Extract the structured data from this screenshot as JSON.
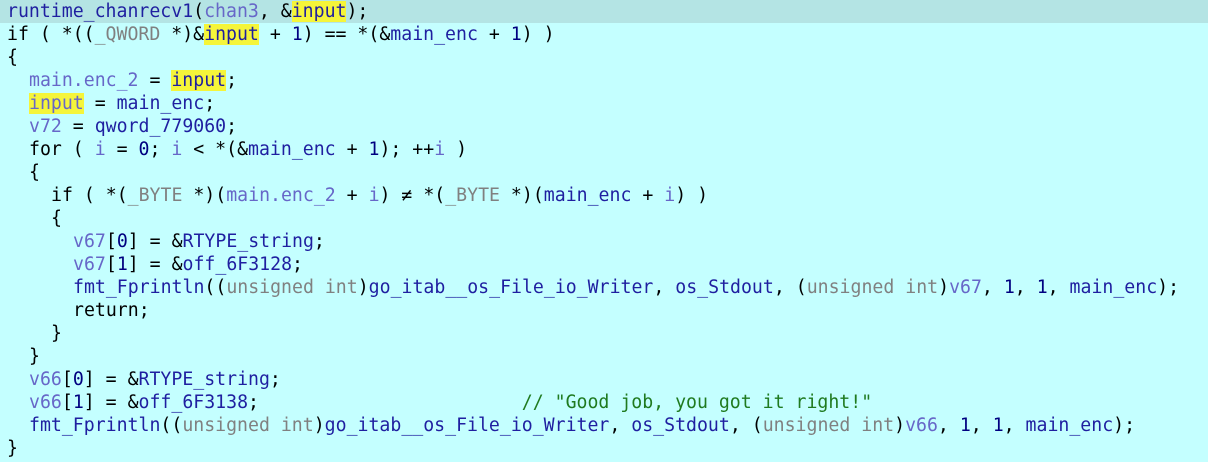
{
  "editor": {
    "lines": [
      {
        "indent": 0,
        "current": true,
        "tokens": [
          {
            "t": "runtime_chanrecv1",
            "c": "name"
          },
          {
            "t": "(",
            "c": "op"
          },
          {
            "t": "chan3",
            "c": "var"
          },
          {
            "t": ", &",
            "c": "op"
          },
          {
            "t": "input",
            "c": "name",
            "hl": true
          },
          {
            "t": ");",
            "c": "op"
          }
        ]
      },
      {
        "indent": 0,
        "tokens": [
          {
            "t": "if ( *((",
            "c": "kw"
          },
          {
            "t": "_QWORD",
            "c": "type"
          },
          {
            "t": " *)&",
            "c": "op"
          },
          {
            "t": "input",
            "c": "name",
            "hl": true
          },
          {
            "t": " + ",
            "c": "op"
          },
          {
            "t": "1",
            "c": "num"
          },
          {
            "t": ") == *(&",
            "c": "op"
          },
          {
            "t": "main_enc",
            "c": "name"
          },
          {
            "t": " + ",
            "c": "op"
          },
          {
            "t": "1",
            "c": "num"
          },
          {
            "t": ") )",
            "c": "op"
          }
        ]
      },
      {
        "indent": 0,
        "tokens": [
          {
            "t": "{",
            "c": "op"
          }
        ]
      },
      {
        "indent": 1,
        "tokens": [
          {
            "t": "main.enc_2",
            "c": "var"
          },
          {
            "t": " = ",
            "c": "op"
          },
          {
            "t": "input",
            "c": "name",
            "hl": true
          },
          {
            "t": ";",
            "c": "op"
          }
        ]
      },
      {
        "indent": 1,
        "tokens": [
          {
            "t": "input",
            "c": "var",
            "hl": true
          },
          {
            "t": " = ",
            "c": "op"
          },
          {
            "t": "main_enc",
            "c": "name"
          },
          {
            "t": ";",
            "c": "op"
          }
        ]
      },
      {
        "indent": 1,
        "tokens": [
          {
            "t": "v72",
            "c": "var"
          },
          {
            "t": " = ",
            "c": "op"
          },
          {
            "t": "qword_779060",
            "c": "name"
          },
          {
            "t": ";",
            "c": "op"
          }
        ]
      },
      {
        "indent": 1,
        "tokens": [
          {
            "t": "for ( ",
            "c": "kw"
          },
          {
            "t": "i",
            "c": "var"
          },
          {
            "t": " = ",
            "c": "op"
          },
          {
            "t": "0",
            "c": "num"
          },
          {
            "t": "; ",
            "c": "op"
          },
          {
            "t": "i",
            "c": "var"
          },
          {
            "t": " < *(&",
            "c": "op"
          },
          {
            "t": "main_enc",
            "c": "name"
          },
          {
            "t": " + ",
            "c": "op"
          },
          {
            "t": "1",
            "c": "num"
          },
          {
            "t": "); ++",
            "c": "op"
          },
          {
            "t": "i",
            "c": "var"
          },
          {
            "t": " )",
            "c": "op"
          }
        ]
      },
      {
        "indent": 1,
        "tokens": [
          {
            "t": "{",
            "c": "op"
          }
        ]
      },
      {
        "indent": 2,
        "tokens": [
          {
            "t": "if ( *(",
            "c": "kw"
          },
          {
            "t": "_BYTE",
            "c": "type"
          },
          {
            "t": " *)(",
            "c": "op"
          },
          {
            "t": "main.enc_2",
            "c": "var"
          },
          {
            "t": " + ",
            "c": "op"
          },
          {
            "t": "i",
            "c": "var"
          },
          {
            "t": ") ≠ *(",
            "c": "op"
          },
          {
            "t": "_BYTE",
            "c": "type"
          },
          {
            "t": " *)(",
            "c": "op"
          },
          {
            "t": "main_enc",
            "c": "name"
          },
          {
            "t": " + ",
            "c": "op"
          },
          {
            "t": "i",
            "c": "var"
          },
          {
            "t": ") )",
            "c": "op"
          }
        ]
      },
      {
        "indent": 2,
        "tokens": [
          {
            "t": "{",
            "c": "op"
          }
        ]
      },
      {
        "indent": 3,
        "tokens": [
          {
            "t": "v67",
            "c": "var"
          },
          {
            "t": "[",
            "c": "op"
          },
          {
            "t": "0",
            "c": "num"
          },
          {
            "t": "] = &",
            "c": "op"
          },
          {
            "t": "RTYPE_string",
            "c": "name"
          },
          {
            "t": ";",
            "c": "op"
          }
        ]
      },
      {
        "indent": 3,
        "tokens": [
          {
            "t": "v67",
            "c": "var"
          },
          {
            "t": "[",
            "c": "op"
          },
          {
            "t": "1",
            "c": "num"
          },
          {
            "t": "] = &",
            "c": "op"
          },
          {
            "t": "off_6F3128",
            "c": "name"
          },
          {
            "t": ";",
            "c": "op"
          }
        ]
      },
      {
        "indent": 3,
        "tokens": [
          {
            "t": "fmt_Fprintln",
            "c": "name"
          },
          {
            "t": "((",
            "c": "op"
          },
          {
            "t": "unsigned int",
            "c": "type"
          },
          {
            "t": ")",
            "c": "op"
          },
          {
            "t": "go_itab__os_File_io_Writer",
            "c": "name"
          },
          {
            "t": ", ",
            "c": "op"
          },
          {
            "t": "os_Stdout",
            "c": "name"
          },
          {
            "t": ", (",
            "c": "op"
          },
          {
            "t": "unsigned int",
            "c": "type"
          },
          {
            "t": ")",
            "c": "op"
          },
          {
            "t": "v67",
            "c": "var"
          },
          {
            "t": ", ",
            "c": "op"
          },
          {
            "t": "1",
            "c": "num"
          },
          {
            "t": ", ",
            "c": "op"
          },
          {
            "t": "1",
            "c": "num"
          },
          {
            "t": ", ",
            "c": "op"
          },
          {
            "t": "main_enc",
            "c": "name"
          },
          {
            "t": ");",
            "c": "op"
          }
        ]
      },
      {
        "indent": 3,
        "tokens": [
          {
            "t": "return;",
            "c": "kw"
          }
        ]
      },
      {
        "indent": 2,
        "tokens": [
          {
            "t": "}",
            "c": "op"
          }
        ]
      },
      {
        "indent": 1,
        "tokens": [
          {
            "t": "}",
            "c": "op"
          }
        ]
      },
      {
        "indent": 1,
        "tokens": [
          {
            "t": "v66",
            "c": "var"
          },
          {
            "t": "[",
            "c": "op"
          },
          {
            "t": "0",
            "c": "num"
          },
          {
            "t": "] = &",
            "c": "op"
          },
          {
            "t": "RTYPE_string",
            "c": "name"
          },
          {
            "t": ";",
            "c": "op"
          }
        ]
      },
      {
        "indent": 1,
        "tokens": [
          {
            "t": "v66",
            "c": "var"
          },
          {
            "t": "[",
            "c": "op"
          },
          {
            "t": "1",
            "c": "num"
          },
          {
            "t": "] = &",
            "c": "op"
          },
          {
            "t": "off_6F3138",
            "c": "name"
          },
          {
            "t": ";                        ",
            "c": "op"
          },
          {
            "t": "// \"Good job, you got it right!\"",
            "c": "cmt"
          }
        ]
      },
      {
        "indent": 1,
        "tokens": [
          {
            "t": "fmt_Fprintln",
            "c": "name"
          },
          {
            "t": "((",
            "c": "op"
          },
          {
            "t": "unsigned int",
            "c": "type"
          },
          {
            "t": ")",
            "c": "op"
          },
          {
            "t": "go_itab__os_File_io_Writer",
            "c": "name"
          },
          {
            "t": ", ",
            "c": "op"
          },
          {
            "t": "os_Stdout",
            "c": "name"
          },
          {
            "t": ", (",
            "c": "op"
          },
          {
            "t": "unsigned int",
            "c": "type"
          },
          {
            "t": ")",
            "c": "op"
          },
          {
            "t": "v66",
            "c": "var"
          },
          {
            "t": ", ",
            "c": "op"
          },
          {
            "t": "1",
            "c": "num"
          },
          {
            "t": ", ",
            "c": "op"
          },
          {
            "t": "1",
            "c": "num"
          },
          {
            "t": ", ",
            "c": "op"
          },
          {
            "t": "main_enc",
            "c": "name"
          },
          {
            "t": ");",
            "c": "op"
          }
        ]
      },
      {
        "indent": 0,
        "tokens": [
          {
            "t": "}",
            "c": "op"
          }
        ]
      }
    ]
  }
}
